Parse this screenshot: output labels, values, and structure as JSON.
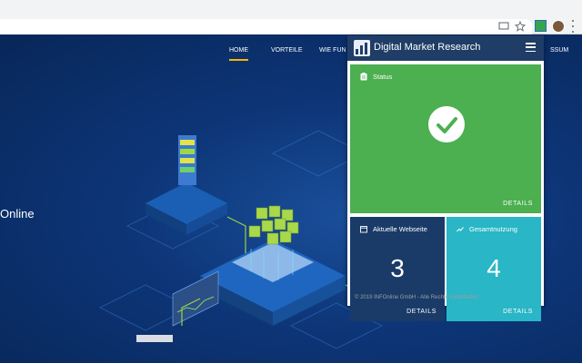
{
  "browser": {
    "ext_icon": "digital-market-research-extension-icon",
    "avatar": "user-avatar"
  },
  "site": {
    "nav": {
      "home": "HOME",
      "vorteile": "VORTEILE",
      "wie": "WIE FUN",
      "ssum": "SSUM"
    },
    "hero_text": "Online",
    "accent_color": "#f5b800"
  },
  "popup": {
    "title": "Digital Market Research",
    "status": {
      "label": "Status",
      "details": "DETAILS",
      "color": "#4caf50"
    },
    "current_site": {
      "label": "Aktuelle Webseite",
      "value": "3",
      "details": "DETAILS",
      "color": "#1a3b68"
    },
    "total_usage": {
      "label": "Gesamtnutzung",
      "value": "4",
      "details": "DETAILS",
      "color": "#29b6c6"
    },
    "footer": "© 2019 INFOnline GmbH - Alle Rechte vorbehalten",
    "header_color": "#1f3d66"
  }
}
